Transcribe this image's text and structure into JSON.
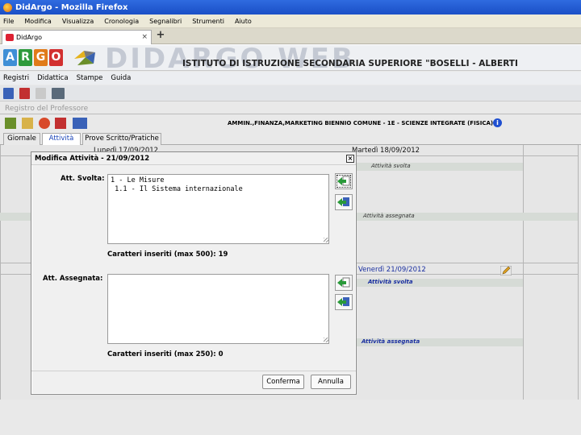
{
  "browser": {
    "window_title": "DidArgo - Mozilla Firefox",
    "menu": [
      "File",
      "Modifica",
      "Visualizza",
      "Cronologia",
      "Segnalibri",
      "Strumenti",
      "Aiuto"
    ],
    "tab_title": "DidArgo",
    "new_tab_symbol": "+"
  },
  "header": {
    "argo_letters": [
      "A",
      "R",
      "G",
      "O"
    ],
    "argo_colors": [
      "#3f8fd6",
      "#2e9a3c",
      "#e07b1a",
      "#d23030"
    ],
    "watermark": "DIDARGO WEB",
    "institute": "ISTITUTO DI ISTRUZIONE SECONDARIA SUPERIORE \"BOSELLI - ALBERTI"
  },
  "app_menu": [
    "Registri",
    "Didattica",
    "Stampe",
    "Guida"
  ],
  "section_title": "Registro del Professore",
  "course_label": "AMMIN.,FINANZA,MARKETING BIENNIO COMUNE - 1E - SCIENZE INTEGRATE (FISICA)",
  "page_tabs": [
    {
      "label": "Giornale",
      "active": false
    },
    {
      "label": "Attività",
      "active": true
    },
    {
      "label": "Prove Scritto/Pratiche",
      "active": false
    }
  ],
  "grid": {
    "col_left_head": "Lunedì 17/09/2012",
    "col_right_head": "Martedì 18/09/2012",
    "right_sub_1": "Attività svolta",
    "right_sub_2": "Attività assegnata",
    "lower_right_head": "Venerdì 21/09/2012",
    "lower_sub_1": "Attività svolta",
    "lower_sub_2": "Attività assegnata"
  },
  "dialog": {
    "title": "Modifica Attività - 21/09/2012",
    "close_symbol": "×",
    "svolta_label": "Att. Svolta:",
    "svolta_text": "1 - Le Misure\n 1.1 - Il Sistema internazionale",
    "svolta_count": "Caratteri inseriti (max 500): 19",
    "assegnata_label": "Att. Assegnata:",
    "assegnata_text": "",
    "assegnata_count": "Caratteri inseriti (max 250): 0",
    "confirm": "Conferma",
    "cancel": "Annulla"
  }
}
